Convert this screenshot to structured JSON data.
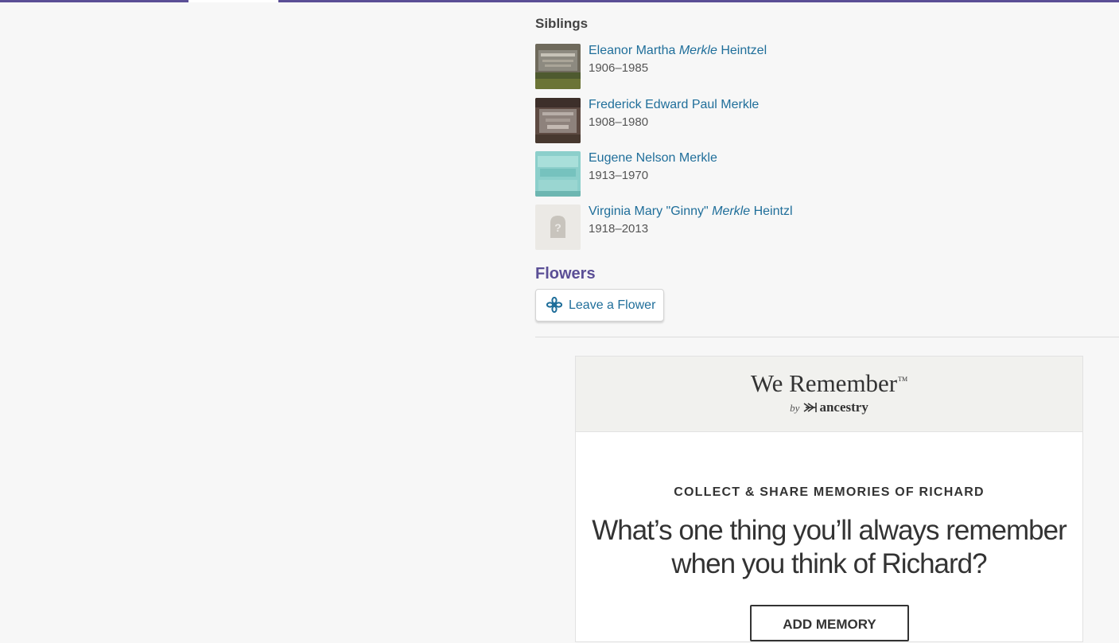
{
  "siblings": {
    "heading": "Siblings",
    "items": [
      {
        "first": "Eleanor Martha",
        "maiden": "Merkle",
        "last": "Heintzel",
        "dates": "1906–1985"
      },
      {
        "first": "Frederick Edward Paul Merkle",
        "maiden": "",
        "last": "",
        "dates": "1908–1980"
      },
      {
        "first": "Eugene Nelson Merkle",
        "maiden": "",
        "last": "",
        "dates": "1913–1970"
      },
      {
        "first": "Virginia Mary \"Ginny\"",
        "maiden": "Merkle",
        "last": "Heintzl",
        "dates": "1918–2013"
      }
    ]
  },
  "flowers": {
    "heading": "Flowers",
    "button_label": "Leave a Flower",
    "button_icon": "flower-icon"
  },
  "we_remember": {
    "title": "We Remember",
    "trademark": "TM",
    "by": "by",
    "brand": "ancestry",
    "kicker": "COLLECT & SHARE MEMORIES OF RICHARD",
    "question": "What’s one thing you’ll always remember when you think of Richard?",
    "button_label": "ADD MEMORY"
  },
  "colors": {
    "accent": "#5b4f96",
    "link": "#1f6e9a",
    "text": "#333333",
    "background": "#f7f7f7"
  }
}
